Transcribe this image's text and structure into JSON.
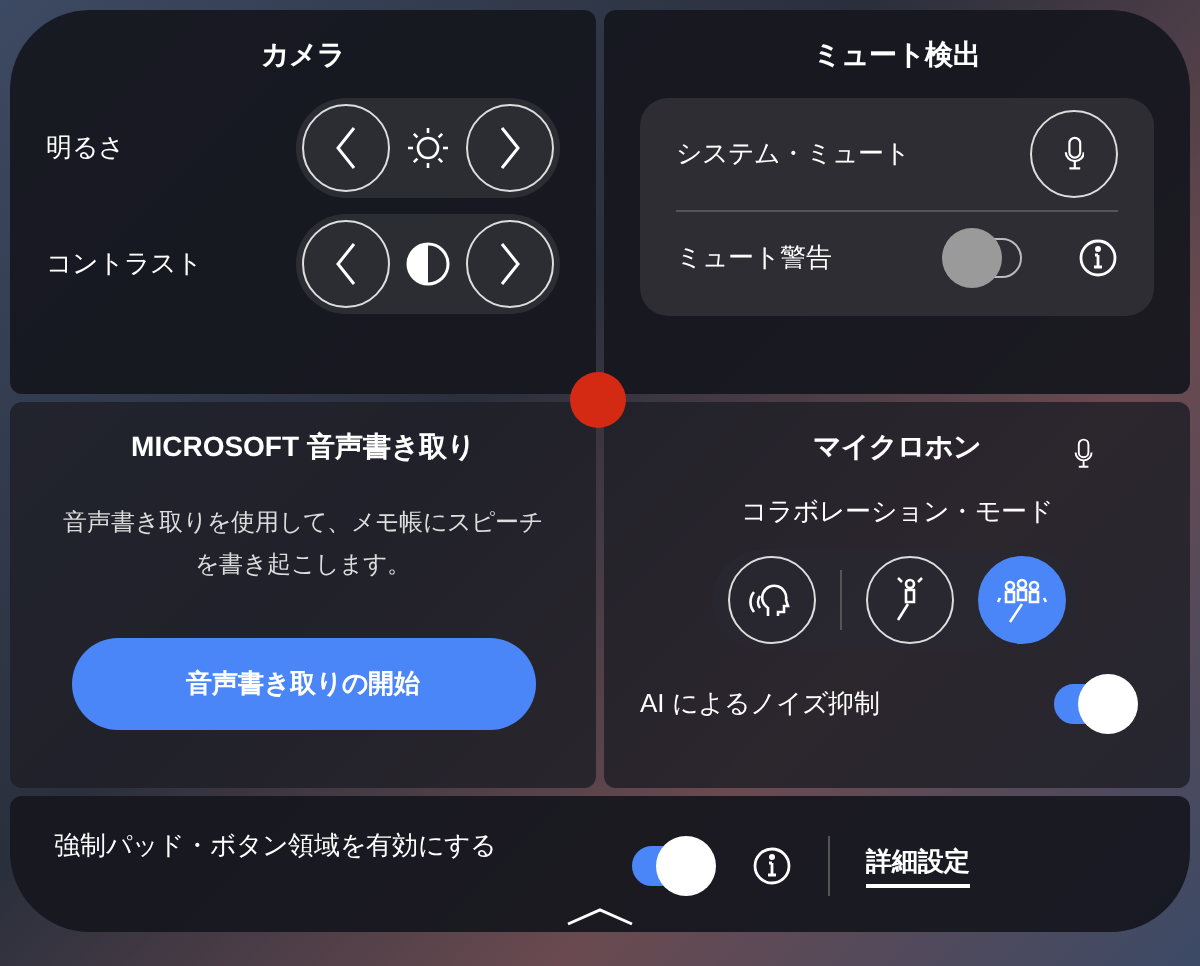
{
  "camera": {
    "title": "カメラ",
    "rows": [
      {
        "label": "明るさ",
        "kind": "brightness"
      },
      {
        "label": "コントラスト",
        "kind": "contrast"
      }
    ]
  },
  "mute_detection": {
    "title": "ミュート検出",
    "system_mute": "システム・ミュート",
    "warning": {
      "label": "ミュート警告",
      "on": false
    }
  },
  "dictation": {
    "title": "MICROSOFT 音声書き取り",
    "description": "音声書き取りを使用して、メモ帳にスピーチを書き起こします。",
    "button": "音声書き取りの開始"
  },
  "microphone": {
    "title": "マイクロホン",
    "mode_label": "コラボレーション・モード",
    "modes": [
      {
        "kind": "personal",
        "selected": false
      },
      {
        "kind": "single",
        "selected": false
      },
      {
        "kind": "group",
        "selected": true
      }
    ],
    "noise": {
      "label": "AI によるノイズ抑制",
      "on": true
    }
  },
  "footer": {
    "label": "強制パッド・ボタン領域を有効にする",
    "on": true,
    "link": "詳細設定"
  }
}
